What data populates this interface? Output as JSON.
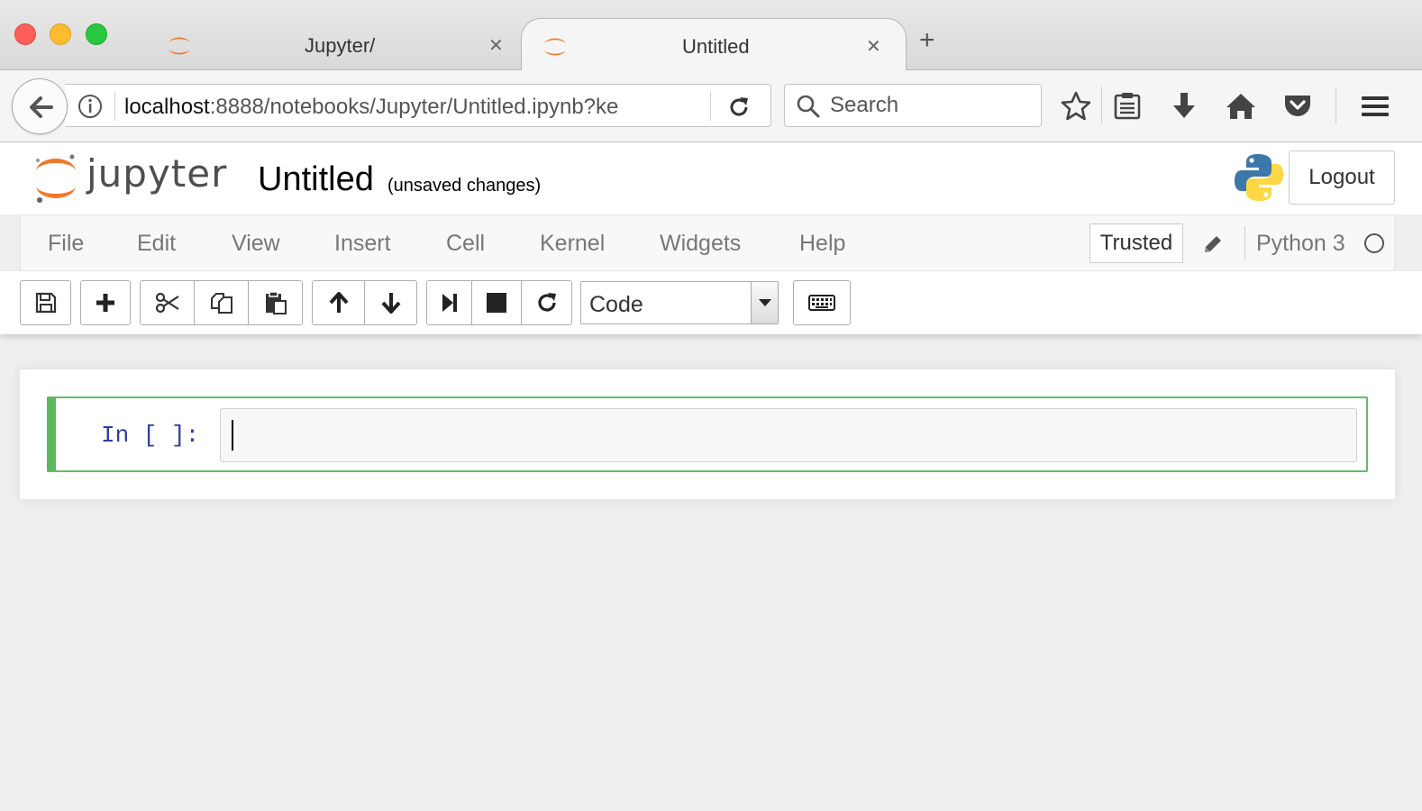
{
  "browser": {
    "tabs": [
      {
        "title": "Jupyter/",
        "active": false
      },
      {
        "title": "Untitled",
        "active": true
      }
    ],
    "new_tab_symbol": "+",
    "close_symbol": "✕",
    "url": {
      "host": "localhost",
      "rest": ":8888/notebooks/Jupyter/Untitled.ipynb?ke"
    },
    "search_placeholder": "Search",
    "toolbar_icons": [
      "star-icon",
      "reading-list-icon",
      "download-icon",
      "home-icon",
      "pocket-icon",
      "hamburger-menu-icon"
    ]
  },
  "jupyter": {
    "logo_text": "jupyter",
    "notebook_title": "Untitled",
    "save_status": "(unsaved changes)",
    "logout_label": "Logout",
    "menus": [
      "File",
      "Edit",
      "View",
      "Insert",
      "Cell",
      "Kernel",
      "Widgets",
      "Help"
    ],
    "trusted_label": "Trusted",
    "kernel_name": "Python 3",
    "cell_type": "Code",
    "cells": [
      {
        "prompt": "In [ ]:",
        "source": ""
      }
    ]
  },
  "colors": {
    "jupyter_orange": "#f37726",
    "cell_selected": "#66bb6a",
    "prompt_blue": "#303f9f"
  }
}
